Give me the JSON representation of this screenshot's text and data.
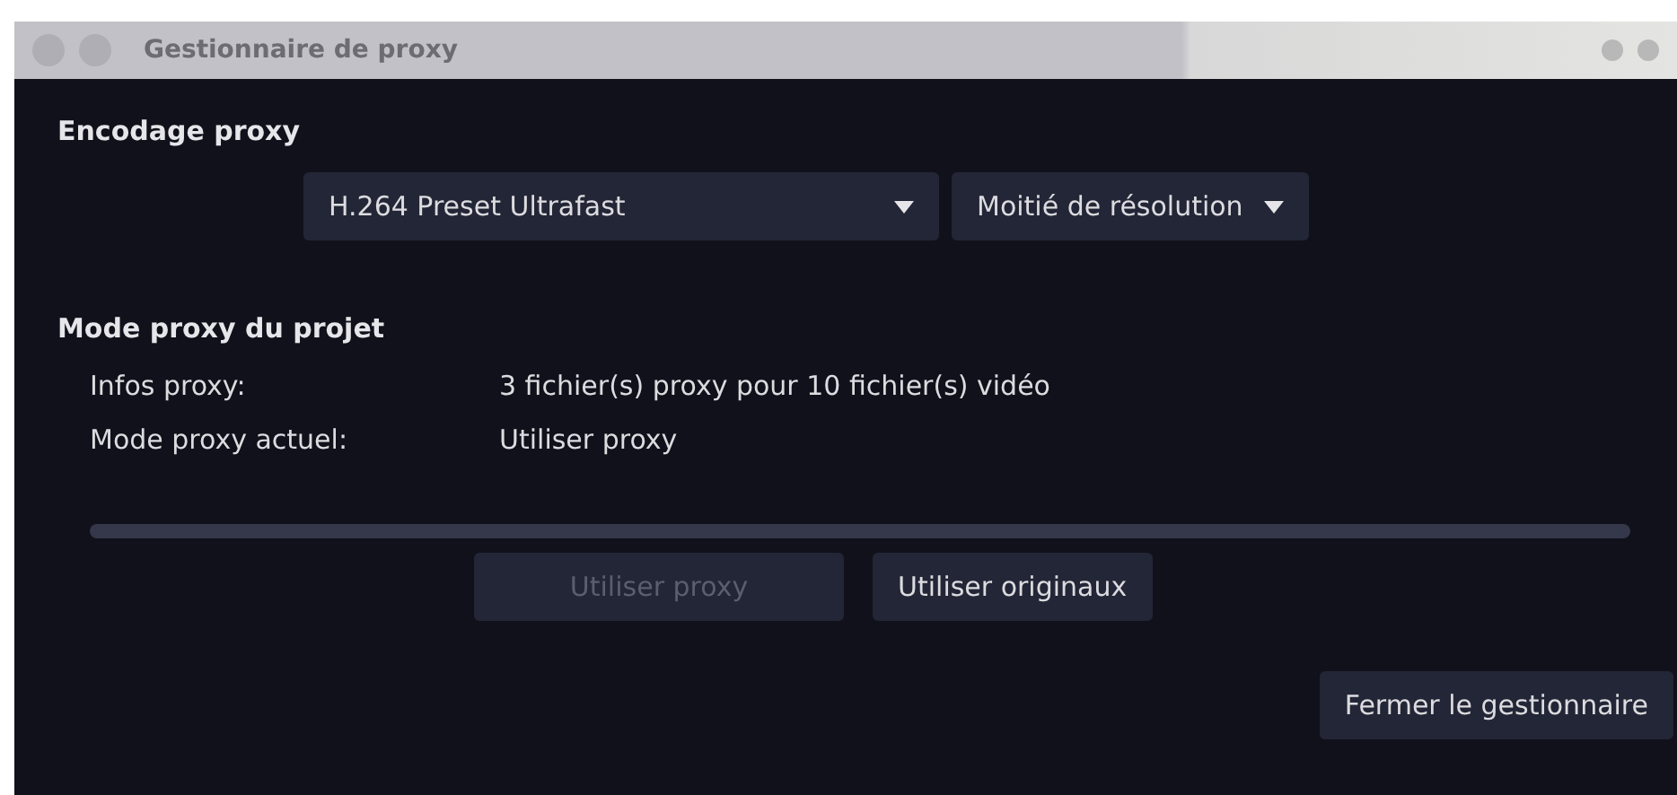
{
  "window": {
    "title": "Gestionnaire de proxy"
  },
  "encoding": {
    "heading": "Encodage proxy",
    "dropdowns": [
      {
        "value": "H.264 Preset Ultrafast"
      },
      {
        "value": "Moitié de résolution"
      }
    ]
  },
  "project": {
    "heading": "Mode proxy du projet",
    "rows": [
      {
        "label": "Infos proxy:",
        "value": "3 fichier(s) proxy pour 10 fichier(s) vidéo"
      },
      {
        "label": "Mode proxy actuel:",
        "value": "Utiliser proxy"
      }
    ]
  },
  "progress": {
    "level": 0
  },
  "mode_buttons": [
    {
      "label": "Utiliser proxy",
      "disabled": true
    },
    {
      "label": "Utiliser originaux",
      "disabled": false
    }
  ],
  "close_button": "Fermer le gestionnaire"
}
